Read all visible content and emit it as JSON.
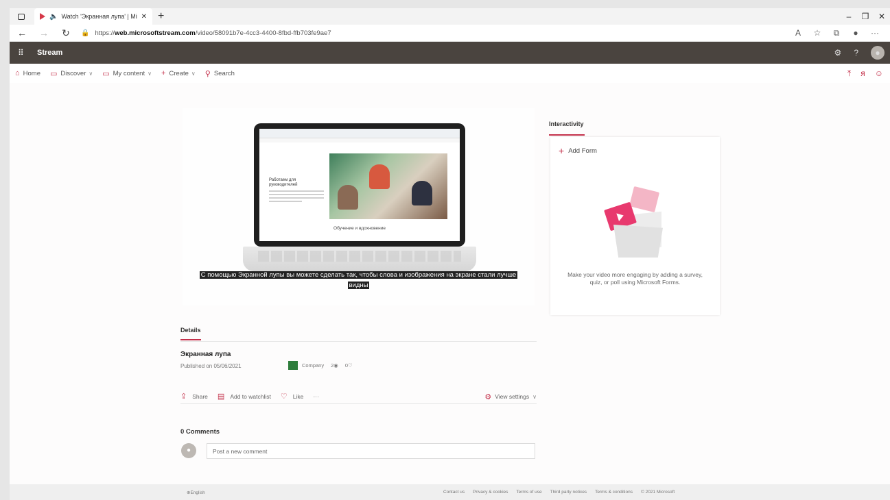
{
  "browser": {
    "tab_title": "Watch 'Экранная лупа' | Mi",
    "url_prefix": "https://",
    "url_domain": "web.microsoftstream.com",
    "url_path": "/video/58091b7e-4cc3-4400-8fbd-ffb703fe9ae7"
  },
  "app": {
    "brand": "Stream"
  },
  "nav": {
    "home": "Home",
    "discover": "Discover",
    "my_content": "My content",
    "create": "Create",
    "search": "Search"
  },
  "video": {
    "screen_heading": "Работаем для руководителей",
    "screen_caption": "Обучение и вдохновение",
    "subtitle_line1": "С помощью Экранной лупы вы можете сделать так, чтобы слова и изображения на экране стали лучше",
    "subtitle_line2": "видны"
  },
  "interactivity": {
    "tab_title": "Interactivity",
    "add_form": "Add Form",
    "description": "Make your video more engaging by adding a survey, quiz, or poll using Microsoft Forms."
  },
  "details": {
    "tab_title": "Details",
    "video_title": "Экранная лупа",
    "published": "Published on 05/06/2021",
    "channel": "Company",
    "views": "2",
    "likes": "0",
    "actions": {
      "share": "Share",
      "watchlist": "Add to watchlist",
      "like": "Like",
      "more": "···",
      "view_settings": "View settings"
    }
  },
  "comments": {
    "title": "0 Comments",
    "placeholder": "Post a new comment"
  },
  "footer": {
    "language": "English",
    "links": [
      "Contact us",
      "Privacy & cookies",
      "Terms of use",
      "Third party notices",
      "Terms & conditions",
      "© 2021 Microsoft"
    ]
  },
  "colors": {
    "accent": "#c4314b",
    "header": "#4a443f"
  },
  "icons": [
    "sidebar-icon",
    "video-favicon",
    "speaker-icon",
    "close-icon",
    "back-icon",
    "forward-icon",
    "refresh-icon",
    "lock-icon",
    "reader-icon",
    "favorite-icon",
    "collections-icon",
    "profile-icon",
    "more-icon",
    "waffle-icon",
    "settings-icon",
    "help-icon",
    "avatar",
    "home-icon",
    "discover-icon",
    "my-content-icon",
    "plus-icon",
    "search-icon",
    "upload-icon",
    "person-icon",
    "smiley-icon",
    "share-icon",
    "watchlist-icon",
    "heart-icon",
    "gear-icon",
    "chevron-down-icon",
    "globe-icon"
  ]
}
